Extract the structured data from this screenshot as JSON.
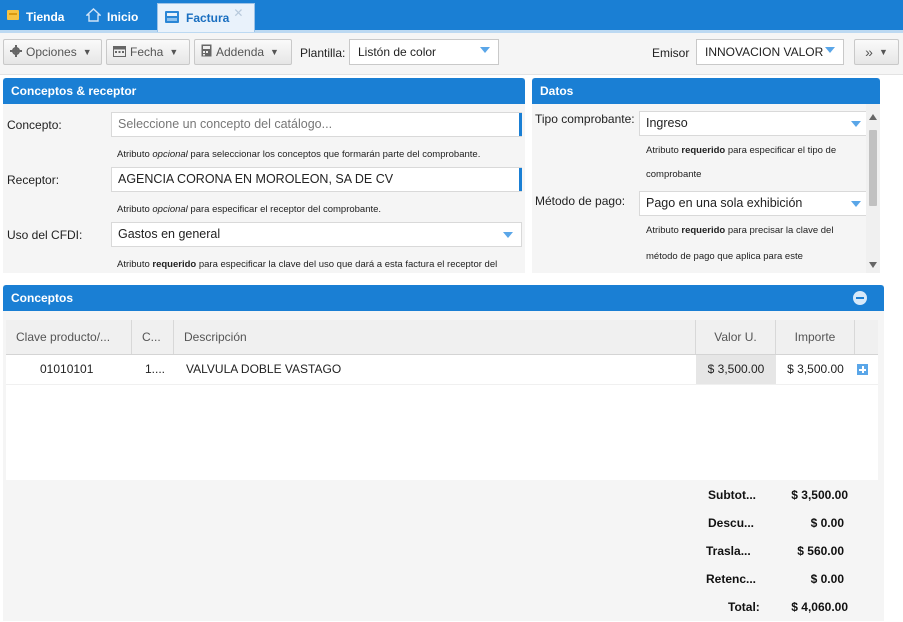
{
  "tabs": [
    {
      "label": "Tienda",
      "icon": "store-icon"
    },
    {
      "label": "Inicio",
      "icon": "home-icon"
    },
    {
      "label": "Factura",
      "icon": "invoice-icon",
      "active": true
    }
  ],
  "toolbar": {
    "opciones_label": "Opciones",
    "fecha_label": "Fecha",
    "addenda_label": "Addenda",
    "plantilla_label": "Plantilla:",
    "plantilla_value": "Listón de color",
    "emisor_label": "Emisor",
    "emisor_value": "INNOVACION VALOR",
    "more_label": "»"
  },
  "conceptos_receptor": {
    "title": "Conceptos & receptor",
    "concepto_label": "Concepto:",
    "concepto_placeholder": "Seleccione un concepto del catálogo...",
    "concepto_hint_pre": "Atributo ",
    "concepto_hint_em": "opcional",
    "concepto_hint_post": " para seleccionar los conceptos que formarán parte del comprobante.",
    "receptor_label": "Receptor:",
    "receptor_value": "AGENCIA CORONA EN MOROLEON, SA DE CV",
    "receptor_hint_pre": "Atributo ",
    "receptor_hint_em": "opcional",
    "receptor_hint_post": " para especificar el receptor del comprobante.",
    "uso_label": "Uso del CFDI:",
    "uso_value": "Gastos en general",
    "uso_hint_pre": "Atributo ",
    "uso_hint_strong": "requerido",
    "uso_hint_post": " para especificar la clave del uso que dará a esta factura el receptor del"
  },
  "datos": {
    "title": "Datos",
    "tipo_label": "Tipo comprobante:",
    "tipo_value": "Ingreso",
    "tipo_hint_pre": "Atributo ",
    "tipo_hint_strong": "requerido",
    "tipo_hint_post": " para especificar el tipo de",
    "tipo_hint_line2": "comprobante",
    "metodo_label": "Método de pago:",
    "metodo_value": "Pago en una sola exhibición",
    "metodo_hint_pre": "Atributo ",
    "metodo_hint_strong": "requerido",
    "metodo_hint_post": " para precisar la clave del",
    "metodo_hint_line2": "método de pago que aplica para este"
  },
  "conceptos": {
    "title": "Conceptos",
    "columns": [
      "Clave producto/...",
      "C...",
      "Descripción",
      "Valor U.",
      "Importe"
    ],
    "rows": [
      {
        "clave": "01010101",
        "cantidad": "1....",
        "descripcion": "VALVULA DOBLE VASTAGO",
        "valor_unitario": "$ 3,500.00",
        "importe": "$ 3,500.00"
      }
    ],
    "totals": [
      {
        "label": "Subtot...",
        "value": "$ 3,500.00"
      },
      {
        "label": "Descu...",
        "value": "$ 0.00"
      },
      {
        "label": "Trasla...",
        "value": "$ 560.00"
      },
      {
        "label": "Retenc...",
        "value": "$ 0.00"
      },
      {
        "label": "Total:",
        "value": "$ 4,060.00"
      }
    ]
  },
  "colors": {
    "accent": "#1a7fd4",
    "panel_bg": "#f5f5f5",
    "dropdown_arrow": "#5aa6e8"
  }
}
